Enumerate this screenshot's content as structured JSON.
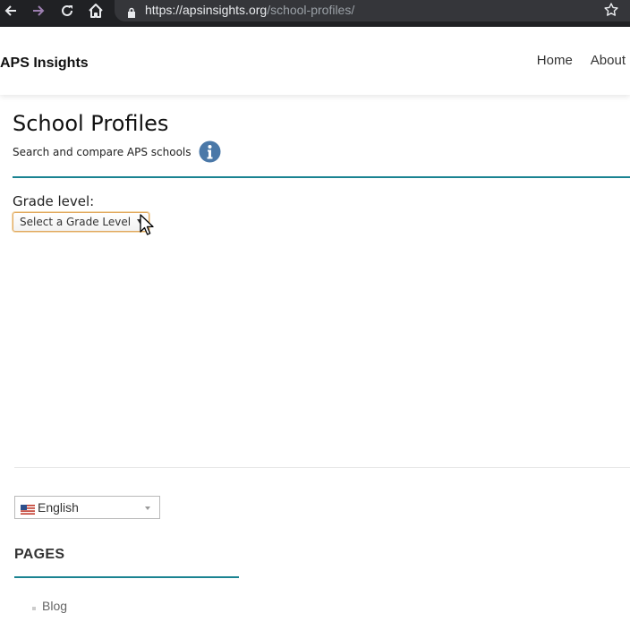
{
  "browser": {
    "url_host": "https://apsinsights.org",
    "url_path": "/school-profiles/",
    "icons": [
      "back-icon",
      "forward-icon",
      "reload-icon",
      "home-icon",
      "lock-icon",
      "star-icon"
    ]
  },
  "header": {
    "brand": "APS Insights",
    "nav": [
      {
        "label": "Home"
      },
      {
        "label": "About"
      }
    ]
  },
  "main": {
    "title": "School Profiles",
    "subtitle": "Search and compare APS schools",
    "grade_label": "Grade level:",
    "grade_select": {
      "value": "Select a Grade Level"
    }
  },
  "footer": {
    "language_select": {
      "value": "English"
    },
    "pages_heading": "PAGES",
    "pages": [
      {
        "label": "Blog"
      }
    ]
  },
  "colors": {
    "accent_teal": "#1a8391",
    "info_icon": "#4a78a8",
    "chrome_bg": "#202124"
  }
}
